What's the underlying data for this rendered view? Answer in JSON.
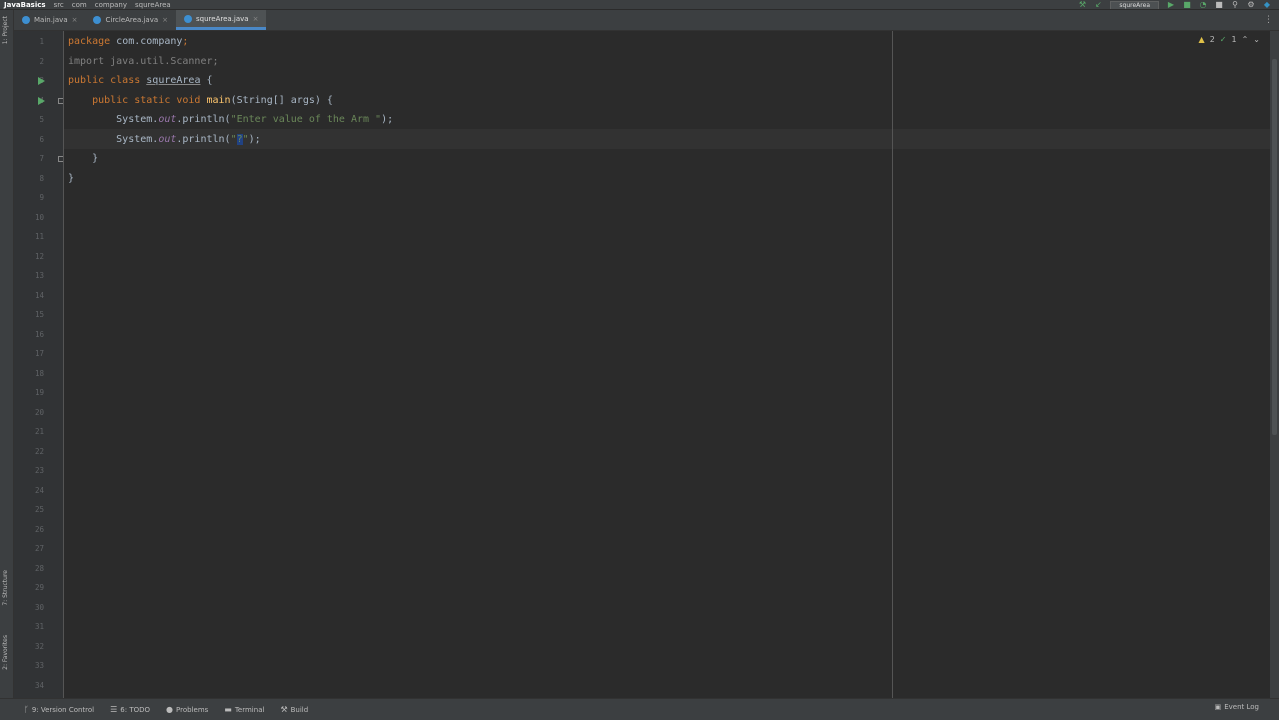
{
  "nav": {
    "project": "JavaBasics",
    "crumbs": [
      "src",
      "com",
      "company",
      "squreArea"
    ],
    "run_config": "squreArea"
  },
  "tabs": [
    {
      "label": "Main.java",
      "active": false
    },
    {
      "label": "CircleArea.java",
      "active": false
    },
    {
      "label": "squreArea.java",
      "active": true
    }
  ],
  "sidebar": {
    "project_label": "1: Project",
    "structure_label": "7: Structure",
    "favorites_label": "2: Favorites"
  },
  "editor": {
    "inspections": {
      "warnings": "2",
      "ok": "1"
    },
    "line_count": 34,
    "lines": [
      [
        {
          "t": "package ",
          "c": "kw"
        },
        {
          "t": "com.company",
          "c": "pkg"
        },
        {
          "t": ";",
          "c": "kw"
        }
      ],
      [
        {
          "t": "import java.util.Scanner;",
          "c": "unused"
        }
      ],
      [
        {
          "t": "public class ",
          "c": "kw"
        },
        {
          "t": "squreArea",
          "c": "cls"
        },
        {
          "t": " {",
          "c": "plain"
        }
      ],
      [
        {
          "t": "    public static void ",
          "c": "kw"
        },
        {
          "t": "main",
          "c": "meth"
        },
        {
          "t": "(String[] args) {",
          "c": "plain"
        }
      ],
      [
        {
          "t": "        System.",
          "c": "plain"
        },
        {
          "t": "out",
          "c": "field"
        },
        {
          "t": ".println(",
          "c": "plain"
        },
        {
          "t": "\"Enter value of the Arm \"",
          "c": "str"
        },
        {
          "t": ");",
          "c": "plain"
        }
      ],
      [
        {
          "t": "        System.",
          "c": "plain"
        },
        {
          "t": "out",
          "c": "field"
        },
        {
          "t": ".println(",
          "c": "plain"
        },
        {
          "t": "\"",
          "c": "str"
        },
        {
          "t": "?",
          "c": "caret-char"
        },
        {
          "t": "\"",
          "c": "str"
        },
        {
          "t": ");",
          "c": "plain"
        }
      ],
      [
        {
          "t": "    }",
          "c": "plain"
        }
      ],
      [
        {
          "t": "}",
          "c": "plain"
        }
      ]
    ]
  },
  "status": {
    "version_control": "9: Version Control",
    "todo": "6: TODO",
    "problems": "Problems",
    "terminal": "Terminal",
    "build": "Build",
    "event_log": "Event Log"
  }
}
